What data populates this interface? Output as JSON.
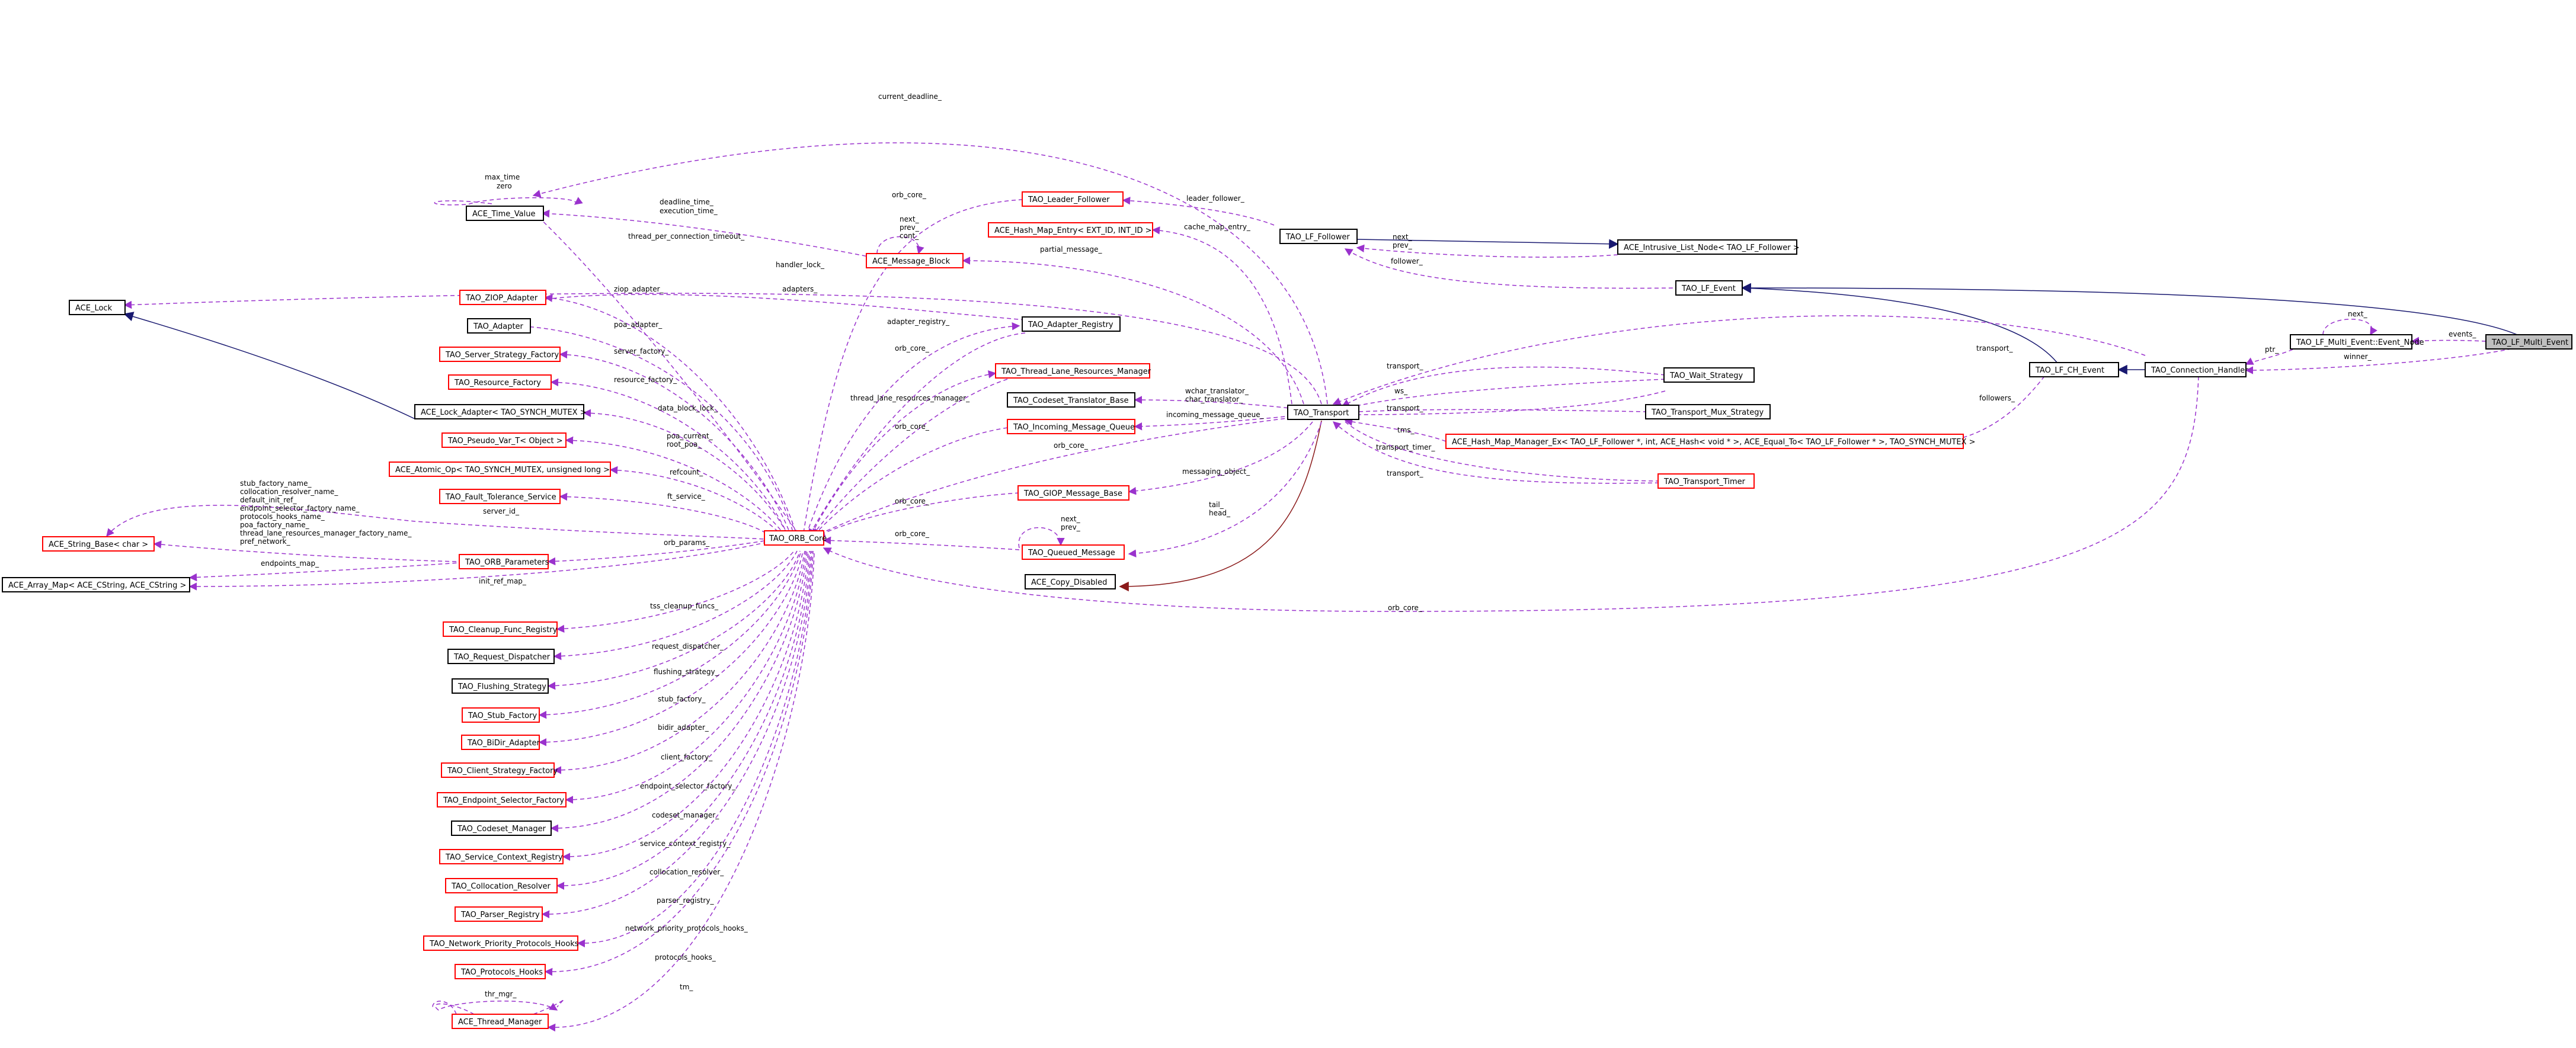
{
  "nodes": {
    "ace_lock": "ACE_Lock",
    "ace_time_value": "ACE_Time_Value",
    "ace_string_base": "ACE_String_Base< char >",
    "ace_array_map": "ACE_Array_Map< ACE_CString, ACE_CString >",
    "ace_lock_adapter": "ACE_Lock_Adapter< TAO_SYNCH_MUTEX >",
    "tao_ziop_adapter": "TAO_ZIOP_Adapter",
    "tao_adapter": "TAO_Adapter",
    "tao_server_strategy_factory": "TAO_Server_Strategy_Factory",
    "tao_resource_factory": "TAO_Resource_Factory",
    "tao_pseudo_var": "TAO_Pseudo_Var_T< Object >",
    "ace_atomic_op": "ACE_Atomic_Op< TAO_SYNCH_MUTEX, unsigned long >",
    "tao_fault_tolerance_service": "TAO_Fault_Tolerance_Service",
    "tao_orb_parameters": "TAO_ORB_Parameters",
    "tao_cleanup_func_registry": "TAO_Cleanup_Func_Registry",
    "tao_request_dispatcher": "TAO_Request_Dispatcher",
    "tao_flushing_strategy": "TAO_Flushing_Strategy",
    "tao_stub_factory": "TAO_Stub_Factory",
    "tao_bidir_adapter": "TAO_BiDir_Adapter",
    "tao_client_strategy_factory": "TAO_Client_Strategy_Factory",
    "tao_endpoint_selector_factory": "TAO_Endpoint_Selector_Factory",
    "tao_codeset_manager": "TAO_Codeset_Manager",
    "tao_service_context_registry": "TAO_Service_Context_Registry",
    "tao_collocation_resolver": "TAO_Collocation_Resolver",
    "tao_parser_registry": "TAO_Parser_Registry",
    "tao_network_priority_protocols_hooks": "TAO_Network_Priority_Protocols_Hooks",
    "tao_protocols_hooks": "TAO_Protocols_Hooks",
    "ace_thread_manager": "ACE_Thread_Manager",
    "tao_orb_core": "TAO_ORB_Core",
    "ace_message_block": "ACE_Message_Block",
    "tao_leader_follower": "TAO_Leader_Follower",
    "ace_hash_map_entry": "ACE_Hash_Map_Entry< EXT_ID, INT_ID >",
    "tao_adapter_registry": "TAO_Adapter_Registry",
    "tao_thread_lane_resources_manager": "TAO_Thread_Lane_Resources_Manager",
    "tao_codeset_translator_base": "TAO_Codeset_Translator_Base",
    "tao_incoming_message_queue": "TAO_Incoming_Message_Queue",
    "tao_giop_message_base": "TAO_GIOP_Message_Base",
    "tao_queued_message": "TAO_Queued_Message",
    "ace_copy_disabled": "ACE_Copy_Disabled",
    "tao_transport": "TAO_Transport",
    "tao_lf_follower": "TAO_LF_Follower",
    "ace_intrusive_list_node": "ACE_Intrusive_List_Node< TAO_LF_Follower >",
    "tao_lf_event": "TAO_LF_Event",
    "tao_wait_strategy": "TAO_Wait_Strategy",
    "tao_transport_mux_strategy": "TAO_Transport_Mux_Strategy",
    "ace_hash_map_manager_ex": "ACE_Hash_Map_Manager_Ex< TAO_LF_Follower *, int, ACE_Hash< void * >, ACE_Equal_To< TAO_LF_Follower * >, TAO_SYNCH_MUTEX >",
    "tao_transport_timer": "TAO_Transport_Timer",
    "tao_lf_ch_event": "TAO_LF_CH_Event",
    "tao_connection_handler": "TAO_Connection_Handler",
    "tao_lf_multi_event_node": "TAO_LF_Multi_Event::Event_Node",
    "tao_lf_multi_event": "TAO_LF_Multi_Event"
  },
  "edge_labels": {
    "current_deadline": "current_deadline_",
    "max_time_zero": "max_time\nzero",
    "deadline_time": "deadline_time_\nexecution_time_",
    "thread_per_connection_timeout": "thread_per_connection_timeout_",
    "orb_core_1": "orb_core_",
    "next_prev_cont": "next_\nprev_\ncont_",
    "handler_lock": "handler_lock_",
    "zio_adapter": "ziop_adapter_",
    "adapters": "adapters_",
    "poa_adapter": "poa_adapter_",
    "server_factory": "server_factory_",
    "resource_factory": "resource_factory_",
    "data_block_lock": "data_block_lock_",
    "poa_current": "poa_current_\nroot_poa_",
    "refcount": "refcount_",
    "ft_service": "ft_service_",
    "server_id": "server_id_",
    "stub_factory_names": "stub_factory_name_\ncollocation_resolver_name_\ndefault_init_ref_\nendpoint_selector_factory_name_\nprotocols_hooks_name_\npoa_factory_name_\nthread_lane_resources_manager_factory_name_\npref_network_",
    "orb_params": "orb_params_",
    "endpoints_map": "endpoints_map_",
    "init_ref_map": "init_ref_map_",
    "tss_cleanup_funcs": "tss_cleanup_funcs_",
    "request_dispatcher": "request_dispatcher_",
    "flushing_strategy": "flushing_strategy_",
    "stub_factory": "stub_factory_",
    "bidir_adapter": "bidir_adapter_",
    "client_factory": "client_factory_",
    "endpoint_selector_factory": "endpoint_selector_factory_",
    "codeset_manager": "codeset_manager_",
    "service_context_registry": "service_context_registry_",
    "collocation_resolver": "collocation_resolver_",
    "parser_registry": "parser_registry_",
    "network_priority_protocols_hooks": "network_priority_protocols_hooks_",
    "protocols_hooks": "protocols_hooks_",
    "thr_mgr_self": "thr_mgr_",
    "tm": "tm_",
    "adapter_registry": "adapter_registry_",
    "orb_core_2": "orb_core_",
    "thread_lane_resources_manager": "thread_lane_resources_manager_",
    "orb_core_3": "orb_core_",
    "orb_core_4": "orb_core_",
    "orb_core_5": "orb_core_",
    "orb_core_6": "orb_core_",
    "next_prev_qm": "next_\nprev_",
    "orb_core_long": "orb_core_",
    "leader_follower": "leader_follower_",
    "cache_map_entry": "cache_map_entry_",
    "partial_message": "partial_message_",
    "wchar_char_translator": "wchar_translator_\nchar_translator_",
    "incoming_message_queue": "incoming_message_queue_",
    "messaging_object": "messaging_object_",
    "tail_head": "tail_\nhead_",
    "next_prev_lf": "next_\nprev_",
    "follower": "follower_",
    "transport_1": "transport_",
    "ws": "ws_",
    "transport_2": "transport_",
    "tms": "tms_",
    "transport_timer": "transport_timer_",
    "transport_3": "transport_",
    "transport_4": "transport_",
    "followers": "followers_",
    "ptr": "ptr_",
    "next_event_node": "next_",
    "events": "events_",
    "winner": "winner_"
  }
}
